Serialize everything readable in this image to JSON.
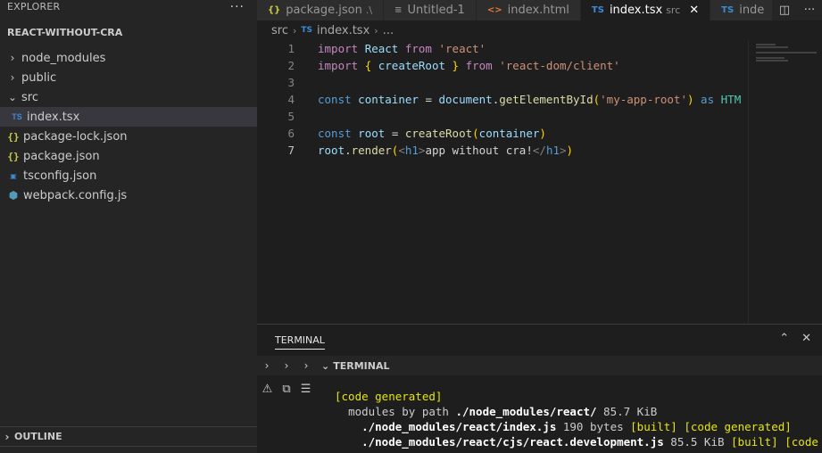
{
  "sidebar": {
    "title": "EXPLORER",
    "more": "···",
    "project": "REACT-WITHOUT-CRA",
    "items": [
      {
        "label": "node_modules",
        "type": "folder",
        "open": false
      },
      {
        "label": "public",
        "type": "folder",
        "open": false
      },
      {
        "label": "src",
        "type": "folder",
        "open": true
      },
      {
        "label": "index.tsx",
        "type": "ts",
        "active": true
      },
      {
        "label": "package-lock.json",
        "type": "json"
      },
      {
        "label": "package.json",
        "type": "json"
      },
      {
        "label": "tsconfig.json",
        "type": "tsconfig"
      },
      {
        "label": "webpack.config.js",
        "type": "webpack"
      }
    ],
    "outline": "OUTLINE"
  },
  "tabs": [
    {
      "label": "package.json",
      "suffix": ".\\",
      "icon": "{}"
    },
    {
      "label": "Untitled-1",
      "suffix": "",
      "icon": "≡"
    },
    {
      "label": "index.html",
      "suffix": "",
      "icon": "<>"
    },
    {
      "label": "index.tsx",
      "suffix": "src",
      "icon": "TS",
      "active": true,
      "close": "✕"
    },
    {
      "label": "inde",
      "suffix": "",
      "icon": "TS"
    }
  ],
  "breadcrumb": {
    "folder": "src",
    "file_icon": "TS",
    "file": "index.tsx",
    "more": "..."
  },
  "editor": {
    "line_numbers": [
      "1",
      "2",
      "3",
      "4",
      "5",
      "6",
      "7"
    ],
    "current_line": "7",
    "lines": {
      "l1": {
        "kw": "import",
        "id": "React",
        "from": "from",
        "str": "'react'"
      },
      "l2": {
        "kw": "import",
        "open": "{",
        "id": "createRoot",
        "close": "}",
        "from": "from",
        "str": "'react-dom/client'"
      },
      "l4": {
        "kw": "const",
        "var": "container",
        "eq": "=",
        "obj": "document",
        "fn": ".getElementById",
        "paren": "(",
        "str": "'my-app-root'",
        "paren2": ")",
        "as": "as",
        "type": "HTM"
      },
      "l6": {
        "kw": "const",
        "var": "root",
        "eq": "=",
        "fn": "createRoot",
        "paren": "(",
        "arg": "container",
        "paren2": ")"
      },
      "l7": {
        "obj": "root",
        "fn": ".render",
        "paren": "(",
        "open": "<",
        "tag": "h1",
        "close": ">",
        "text": "app without cra!",
        "open2": "</",
        "tag2": "h1",
        "close2": ">",
        "paren2": ")"
      }
    }
  },
  "panel": {
    "tab": "TERMINAL",
    "section": "TERMINAL",
    "lines": [
      {
        "indent": "",
        "parts": [
          {
            "c": "y",
            "t": "[code generated]"
          }
        ]
      },
      {
        "indent": "  ",
        "parts": [
          {
            "c": "w",
            "t": "modules by path "
          },
          {
            "c": "b",
            "t": "./node_modules/react/"
          },
          {
            "c": "w",
            "t": " 85.7 KiB"
          }
        ]
      },
      {
        "indent": "    ",
        "parts": [
          {
            "c": "b",
            "t": "./node_modules/react/index.js"
          },
          {
            "c": "w",
            "t": " 190 bytes "
          },
          {
            "c": "y",
            "t": "[built] [code generated]"
          }
        ]
      },
      {
        "indent": "    ",
        "parts": [
          {
            "c": "b",
            "t": "./node_modules/react/cjs/react.development.js"
          },
          {
            "c": "w",
            "t": " 85.5 KiB "
          },
          {
            "c": "y",
            "t": "[built] [code ge"
          }
        ]
      }
    ]
  },
  "colors": {
    "accent": "#007acc",
    "background": "#1e1e1e",
    "sidebar": "#252526"
  }
}
